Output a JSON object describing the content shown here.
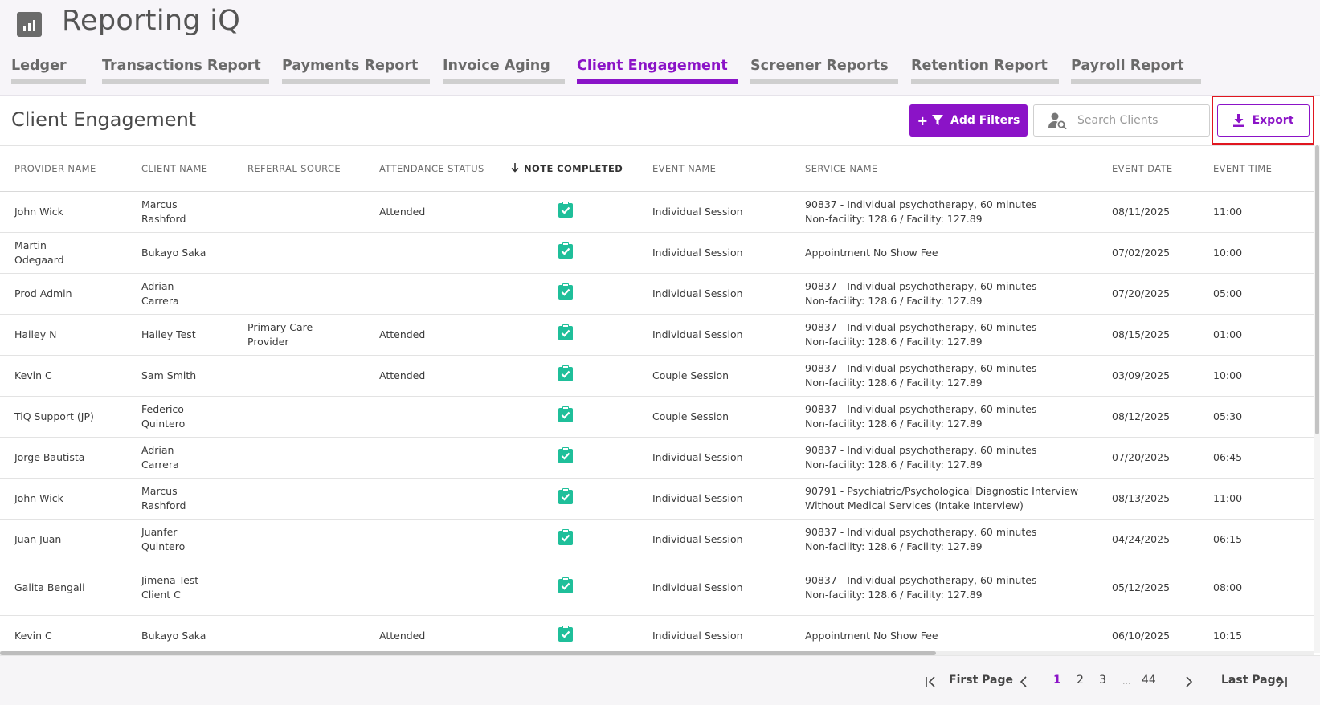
{
  "app": {
    "title": "Reporting iQ",
    "logo_icon": "bar-chart-icon"
  },
  "tabs": [
    {
      "label": "Ledger",
      "active": false
    },
    {
      "label": "Transactions Report",
      "active": false
    },
    {
      "label": "Payments Report",
      "active": false
    },
    {
      "label": "Invoice Aging",
      "active": false
    },
    {
      "label": "Client Engagement",
      "active": true
    },
    {
      "label": "Screener Reports",
      "active": false
    },
    {
      "label": "Retention Report",
      "active": false
    },
    {
      "label": "Payroll Report",
      "active": false
    }
  ],
  "toolbar": {
    "title": "Client Engagement",
    "add_filters_label": "Add Filters",
    "add_filters_plus": "+",
    "search_placeholder": "Search Clients",
    "export_label": "Export"
  },
  "table": {
    "columns": [
      "PROVIDER NAME",
      "CLIENT NAME",
      "REFERRAL SOURCE",
      "ATTENDANCE STATUS",
      "NOTE COMPLETED",
      "EVENT NAME",
      "SERVICE NAME",
      "EVENT DATE",
      "EVENT TIME"
    ],
    "sorted_column": "NOTE COMPLETED",
    "sort_direction": "descending",
    "rows": [
      {
        "provider": "John Wick",
        "client": "Marcus\nRashford",
        "referral": "",
        "attendance": "Attended",
        "note_completed": true,
        "event": "Individual Session",
        "service": "90837 - Individual psychotherapy, 60 minutes\nNon-facility: 128.6 / Facility: 127.89",
        "date": "08/11/2025",
        "time": "11:00"
      },
      {
        "provider": "Martin\nOdegaard",
        "client": "Bukayo Saka",
        "referral": "",
        "attendance": "",
        "note_completed": true,
        "event": "Individual Session",
        "service": "Appointment No Show Fee",
        "date": "07/02/2025",
        "time": "10:00"
      },
      {
        "provider": "Prod Admin",
        "client": "Adrian\nCarrera",
        "referral": "",
        "attendance": "",
        "note_completed": true,
        "event": "Individual Session",
        "service": "90837 - Individual psychotherapy, 60 minutes\nNon-facility: 128.6 / Facility: 127.89",
        "date": "07/20/2025",
        "time": "05:00"
      },
      {
        "provider": "Hailey N",
        "client": "Hailey Test",
        "referral": "Primary Care\nProvider",
        "attendance": "Attended",
        "note_completed": true,
        "event": "Individual Session",
        "service": "90837 - Individual psychotherapy, 60 minutes\nNon-facility: 128.6 / Facility: 127.89",
        "date": "08/15/2025",
        "time": "01:00"
      },
      {
        "provider": "Kevin C",
        "client": "Sam Smith",
        "referral": "",
        "attendance": "Attended",
        "note_completed": true,
        "event": "Couple Session",
        "service": "90837 - Individual psychotherapy, 60 minutes\nNon-facility: 128.6 / Facility: 127.89",
        "date": "03/09/2025",
        "time": "10:00"
      },
      {
        "provider": "TiQ Support (JP)",
        "client": "Federico\nQuintero",
        "referral": "",
        "attendance": "",
        "note_completed": true,
        "event": "Couple Session",
        "service": "90837 - Individual psychotherapy, 60 minutes\nNon-facility: 128.6 / Facility: 127.89",
        "date": "08/12/2025",
        "time": "05:30"
      },
      {
        "provider": "Jorge Bautista",
        "client": "Adrian\nCarrera",
        "referral": "",
        "attendance": "",
        "note_completed": true,
        "event": "Individual Session",
        "service": "90837 - Individual psychotherapy, 60 minutes\nNon-facility: 128.6 / Facility: 127.89",
        "date": "07/20/2025",
        "time": "06:45"
      },
      {
        "provider": "John Wick",
        "client": "Marcus\nRashford",
        "referral": "",
        "attendance": "",
        "note_completed": true,
        "event": "Individual Session",
        "service": "90791 - Psychiatric/Psychological Diagnostic Interview\nWithout Medical Services (Intake Interview)",
        "date": "08/13/2025",
        "time": "11:00"
      },
      {
        "provider": "Juan Juan",
        "client": "Juanfer\nQuintero",
        "referral": "",
        "attendance": "",
        "note_completed": true,
        "event": "Individual Session",
        "service": "90837 - Individual psychotherapy, 60 minutes\nNon-facility: 128.6 / Facility: 127.89",
        "date": "04/24/2025",
        "time": "06:15"
      },
      {
        "provider": "Galita Bengali",
        "client": "Jimena Test\nClient C",
        "referral": "",
        "attendance": "",
        "note_completed": true,
        "event": "Individual Session",
        "service": "90837 - Individual psychotherapy, 60 minutes\nNon-facility: 128.6 / Facility: 127.89",
        "date": "05/12/2025",
        "time": "08:00"
      },
      {
        "provider": "Kevin C",
        "client": "Bukayo Saka",
        "referral": "",
        "attendance": "Attended",
        "note_completed": true,
        "event": "Individual Session",
        "service": "Appointment No Show Fee",
        "date": "06/10/2025",
        "time": "10:15"
      }
    ]
  },
  "pagination": {
    "first_label": "First Page",
    "last_label": "Last Page",
    "pages": [
      "1",
      "2",
      "3"
    ],
    "ellipsis": "...",
    "last_page_number": "44",
    "current_page": "1"
  },
  "colors": {
    "accent": "#8b13c7",
    "check": "#1fbf9a",
    "highlight": "#e0161f"
  }
}
